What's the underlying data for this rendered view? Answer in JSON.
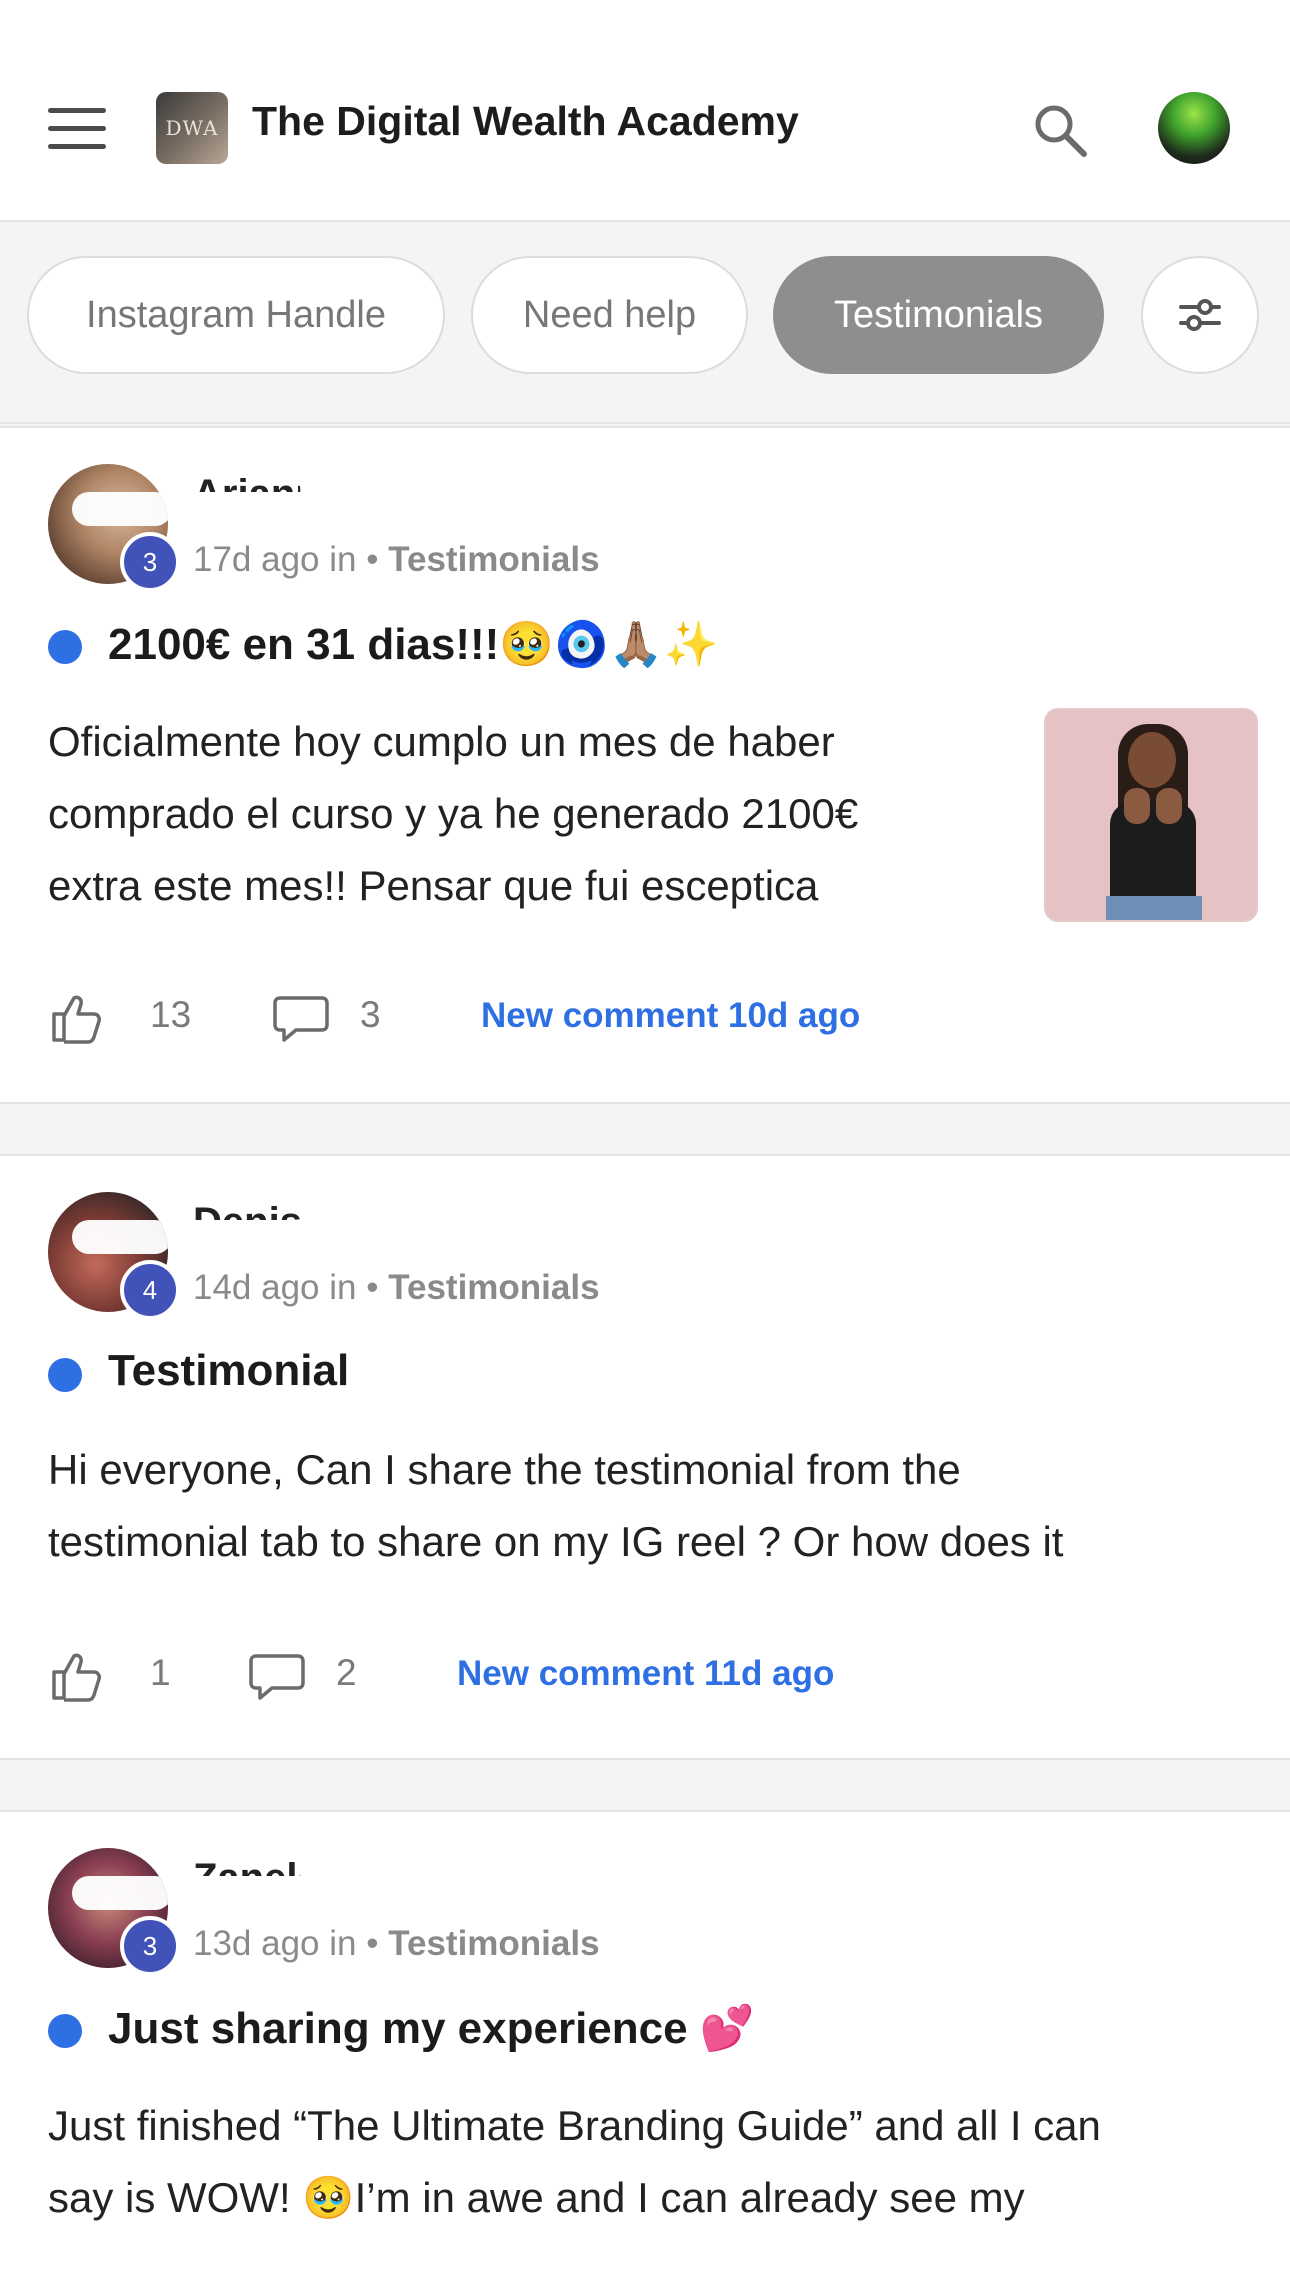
{
  "header": {
    "logo_text": "DWA",
    "title": "The Digital Wealth Academy",
    "icons": {
      "menu": "menu-icon",
      "search": "search-icon"
    }
  },
  "chips": [
    {
      "label": "Instagram Handle",
      "active": false
    },
    {
      "label": "Need help",
      "active": false
    },
    {
      "label": "Testimonials",
      "active": true
    }
  ],
  "posts": [
    {
      "author": "Arianny Lisard...",
      "level": "3",
      "meta_time": "17d ago in •",
      "category": "Testimonials",
      "title": "2100€ en 31 dias!!!🥹🧿🙏🏽✨",
      "body_lines": [
        "Oficialmente hoy cumplo un mes de haber",
        "comprado el curso y ya he generado 2100€",
        "extra este mes!! Pensar que fui esceptica"
      ],
      "likes": "13",
      "comments": "3",
      "new_comment": "New comment 10d ago",
      "has_image": true
    },
    {
      "author": "Denise Verduzco",
      "level": "4",
      "meta_time": "14d ago in •",
      "category": "Testimonials",
      "title": "Testimonial",
      "body_lines": [
        "Hi everyone, Can I share the testimonial from the",
        "testimonial tab to share on my IG reel ? Or how does it"
      ],
      "likes": "1",
      "comments": "2",
      "new_comment": "New comment 11d ago",
      "has_image": false
    },
    {
      "author": "Zanele Masupe",
      "level": "3",
      "meta_time": "13d ago in •",
      "category": "Testimonials",
      "title": "Just sharing my experience 💕",
      "body_lines": [
        "Just finished “The Ultimate Branding Guide” and all I can",
        "say is WOW! 🥹I’m in awe and I can already see my"
      ],
      "has_image": false
    }
  ],
  "colors": {
    "accent_blue": "#2f6fe4",
    "badge": "#4152b8",
    "active_chip": "#8e8e8e"
  }
}
